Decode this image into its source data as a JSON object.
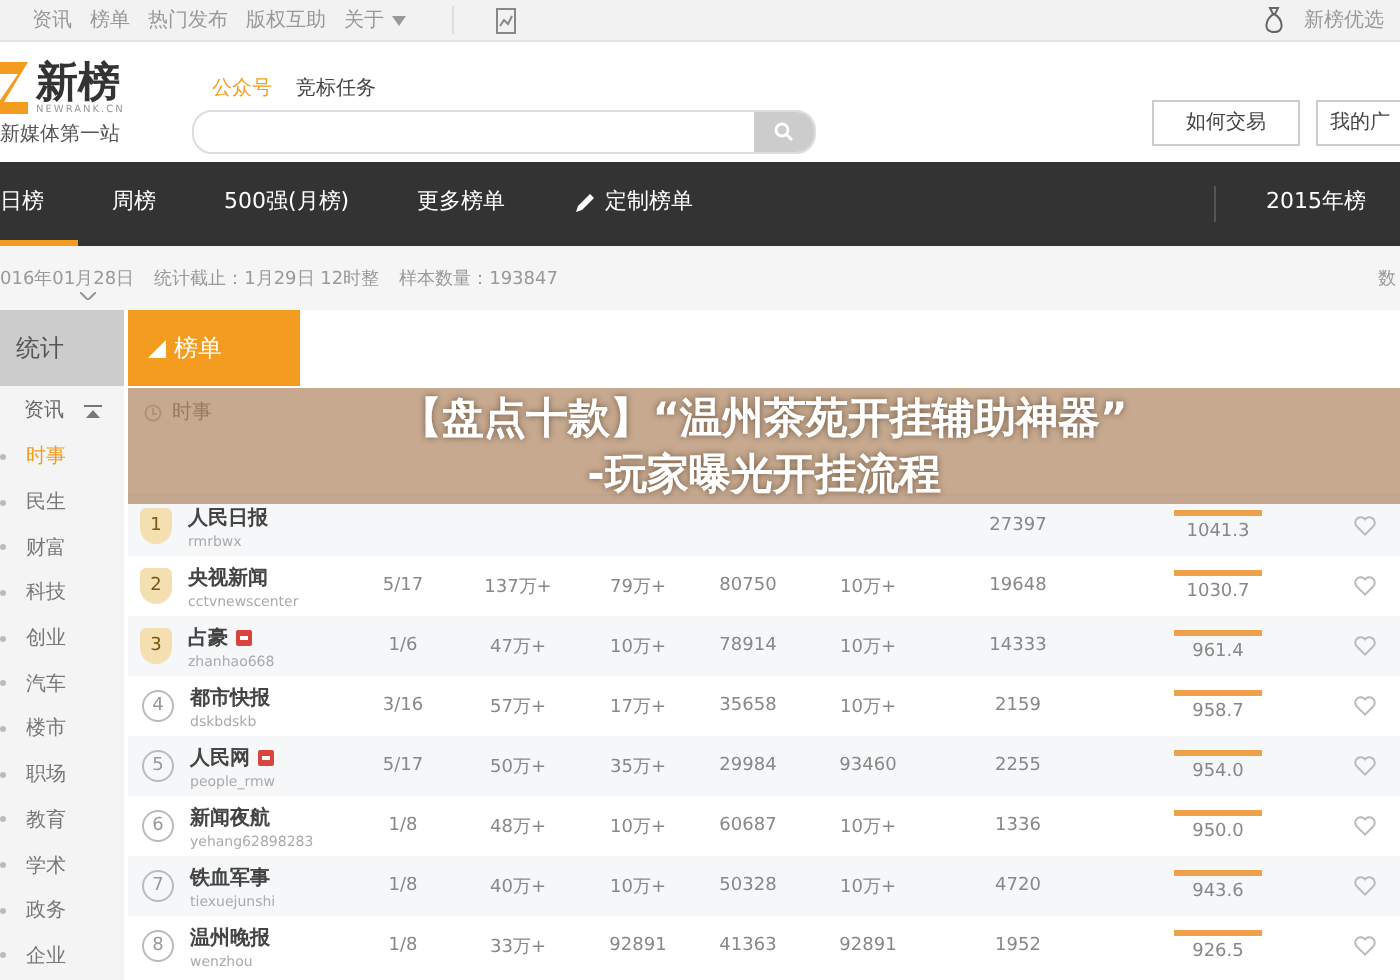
{
  "top_bar": {
    "links": [
      "资讯",
      "榜单",
      "热门发布",
      "版权互助"
    ],
    "menu": "关于",
    "right_link": "新榜优选"
  },
  "logo": {
    "name": "新榜",
    "domain": "NEWRANK.CN",
    "slogan": "新媒体第一站"
  },
  "search_tabs": [
    {
      "label": "公众号",
      "selected": true
    },
    {
      "label": "竞标任务",
      "selected": false
    }
  ],
  "header_buttons": [
    "如何交易",
    "我的广"
  ],
  "nav": {
    "tabs": [
      {
        "label": "日榜",
        "selected": true
      },
      {
        "label": "周榜",
        "selected": false
      },
      {
        "label": "500强(月榜)",
        "selected": false
      },
      {
        "label": "更多榜单",
        "selected": false
      },
      {
        "label": "定制榜单",
        "selected": false,
        "kind": "custom"
      }
    ],
    "right": "2015年榜"
  },
  "info_bar": {
    "date": "016年01月28日",
    "cutoff": "统计截止：1月29日 12时整",
    "sample": "样本数量：193847",
    "right": "数"
  },
  "side_tabs": [
    {
      "label": "统计",
      "selected": false
    },
    {
      "label": "榜单",
      "selected": true
    }
  ],
  "sidebar": {
    "sections": [
      {
        "label": "资讯",
        "expanded": true,
        "children": [
          {
            "label": "时事",
            "selected": true
          },
          {
            "label": "民生",
            "selected": false
          },
          {
            "label": "财富",
            "selected": false
          },
          {
            "label": "科技",
            "selected": false
          },
          {
            "label": "创业",
            "selected": false
          },
          {
            "label": "汽车",
            "selected": false
          },
          {
            "label": "楼市",
            "selected": false
          },
          {
            "label": "职场",
            "selected": false
          },
          {
            "label": "教育",
            "selected": false
          },
          {
            "label": "学术",
            "selected": false
          },
          {
            "label": "政务",
            "selected": false
          },
          {
            "label": "企业",
            "selected": false
          }
        ]
      }
    ]
  },
  "table": {
    "title": "时事",
    "rows": [
      {
        "rank": "1",
        "kind": "medal",
        "name": "人民日报",
        "account": "rmrbwx",
        "badge": false,
        "cells": [
          null,
          null,
          null,
          null,
          null,
          "27397"
        ],
        "index": "1041.3"
      },
      {
        "rank": "2",
        "kind": "medal",
        "name": "央视新闻",
        "account": "cctvnewscenter",
        "badge": false,
        "cells": [
          "5/17",
          "137万+",
          "79万+",
          "80750",
          "10万+",
          "19648"
        ],
        "index": "1030.7"
      },
      {
        "rank": "3",
        "kind": "medal",
        "name": "占豪",
        "account": "zhanhao668",
        "badge": true,
        "cells": [
          "1/6",
          "47万+",
          "10万+",
          "78914",
          "10万+",
          "14333"
        ],
        "index": "961.4"
      },
      {
        "rank": "4",
        "kind": "plain",
        "name": "都市快报",
        "account": "dskbdskb",
        "badge": false,
        "cells": [
          "3/16",
          "57万+",
          "17万+",
          "35658",
          "10万+",
          "2159"
        ],
        "index": "958.7"
      },
      {
        "rank": "5",
        "kind": "plain",
        "name": "人民网",
        "account": "people_rmw",
        "badge": true,
        "cells": [
          "5/17",
          "50万+",
          "35万+",
          "29984",
          "93460",
          "2255"
        ],
        "index": "954.0"
      },
      {
        "rank": "6",
        "kind": "plain",
        "name": "新闻夜航",
        "account": "yehang62898283",
        "badge": false,
        "cells": [
          "1/8",
          "48万+",
          "10万+",
          "60687",
          "10万+",
          "1336"
        ],
        "index": "950.0"
      },
      {
        "rank": "7",
        "kind": "plain",
        "name": "铁血军事",
        "account": "tiexuejunshi",
        "badge": false,
        "cells": [
          "1/8",
          "40万+",
          "10万+",
          "50328",
          "10万+",
          "4720"
        ],
        "index": "943.6"
      },
      {
        "rank": "8",
        "kind": "plain",
        "name": "温州晚报",
        "account": "wenzhou",
        "badge": false,
        "cells": [
          "1/8",
          "33万+",
          "92891",
          "41363",
          "92891",
          "1952"
        ],
        "index": "926.5"
      }
    ]
  },
  "headline": [
    "【盘点十款】“温州茶苑开挂辅助神器”",
    "-玩家曝光开挂流程"
  ]
}
